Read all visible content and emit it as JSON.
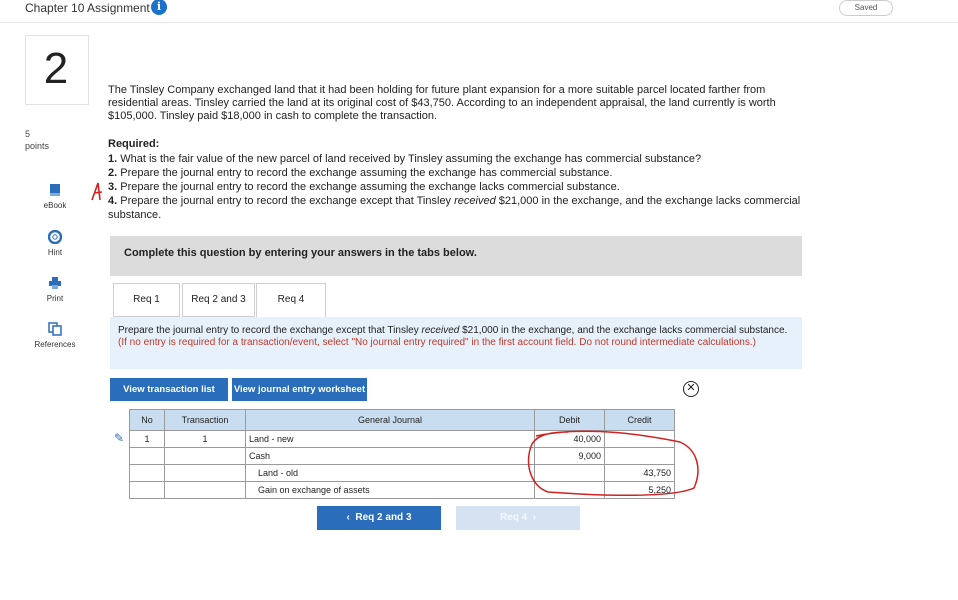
{
  "header": {
    "title": "Chapter 10 Assignment",
    "saved": "Saved"
  },
  "question": {
    "number": "2",
    "points_value": "5",
    "points_label": "points"
  },
  "sidebar": {
    "ebook": "eBook",
    "hint": "Hint",
    "print": "Print",
    "references": "References"
  },
  "problem": {
    "text": "The Tinsley Company exchanged land that it had been holding for future plant expansion for a more suitable parcel located farther from residential areas. Tinsley carried the land at its original cost of $43,750. According to an independent appraisal, the land currently is worth $105,000. Tinsley paid $18,000 in cash to complete the transaction.",
    "required_label": "Required:",
    "req1_num": "1.",
    "req1": "What is the fair value of the new parcel of land received by Tinsley assuming the exchange has commercial substance?",
    "req2_num": "2.",
    "req2": "Prepare the journal entry to record the exchange assuming the exchange has commercial substance.",
    "req3_num": "3.",
    "req3": "Prepare the journal entry to record the exchange assuming the exchange lacks commercial substance.",
    "req4_num": "4.",
    "req4_a": "Prepare the journal entry to record the exchange except that Tinsley ",
    "req4_em": "received",
    "req4_b": " $21,000 in the exchange, and the exchange lacks commercial substance."
  },
  "tabs_panel": {
    "intro": "Complete this question by entering your answers in the tabs below.",
    "tabs": [
      "Req 1",
      "Req 2 and 3",
      "Req 4"
    ],
    "instruction_a": "Prepare the journal entry to record the exchange except that Tinsley ",
    "instruction_em": "received",
    "instruction_b": " $21,000 in the exchange, and the exchange lacks commercial substance. ",
    "instruction_note": "(If no entry is required for a transaction/event, select \"No journal entry required\" in the first account field. Do not round intermediate calculations.)"
  },
  "buttons": {
    "view_transactions": "View transaction list",
    "view_worksheet": "View journal entry worksheet"
  },
  "journal": {
    "headers": [
      "No",
      "Transaction",
      "General Journal",
      "Debit",
      "Credit"
    ],
    "rows": [
      {
        "no": "1",
        "transaction": "1",
        "account": "Land - new",
        "debit": "40,000",
        "credit": ""
      },
      {
        "no": "",
        "transaction": "",
        "account": "Cash",
        "debit": "9,000",
        "credit": ""
      },
      {
        "no": "",
        "transaction": "",
        "account": "Land - old",
        "debit": "",
        "credit": "43,750"
      },
      {
        "no": "",
        "transaction": "",
        "account": "Gain on exchange of assets",
        "debit": "",
        "credit": "5,250"
      }
    ]
  },
  "nav": {
    "prev": "Req 2 and 3",
    "next": "Req 4"
  },
  "colors": {
    "accent": "#2a6ebb",
    "annotation": "#d22020"
  }
}
